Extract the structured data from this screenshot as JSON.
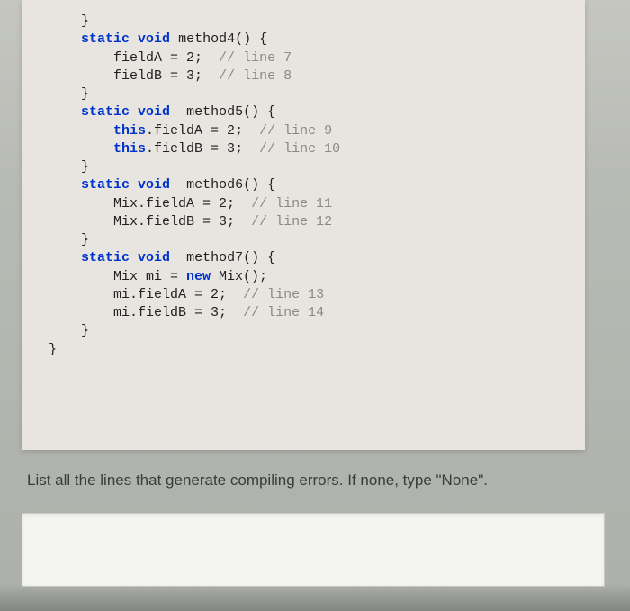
{
  "code": {
    "l0": "    }",
    "blank0": "",
    "m4_sig_indent": "    ",
    "m4_sig_kw1": "static",
    "m4_sig_sp1": " ",
    "m4_sig_kw2": "void",
    "m4_sig_rest": " method4() {",
    "m4_l1": "        fieldA = 2;  // line 7",
    "m4_l1_pre": "        fieldA = ",
    "m4_l1_num": "2",
    "m4_l1_mid": ";  ",
    "m4_l1_cmt": "// line 7",
    "m4_l2_pre": "        fieldB = ",
    "m4_l2_num": "3",
    "m4_l2_mid": ";  ",
    "m4_l2_cmt": "// line 8",
    "m4_close": "    }",
    "blank1": "",
    "m5_sig_indent": "    ",
    "m5_sig_kw1": "static",
    "m5_sig_sp1": " ",
    "m5_sig_kw2": "void",
    "m5_sig_rest": "  method5() {",
    "m5_l1_pre": "        ",
    "m5_l1_this": "this",
    "m5_l1_mid1": ".fieldA = ",
    "m5_l1_num": "2",
    "m5_l1_mid2": ";  ",
    "m5_l1_cmt": "// line 9",
    "m5_l2_pre": "        ",
    "m5_l2_this": "this",
    "m5_l2_mid1": ".fieldB = ",
    "m5_l2_num": "3",
    "m5_l2_mid2": ";  ",
    "m5_l2_cmt": "// line 10",
    "m5_close": "    }",
    "blank2": "",
    "m6_sig_indent": "    ",
    "m6_sig_kw1": "static",
    "m6_sig_sp1": " ",
    "m6_sig_kw2": "void",
    "m6_sig_rest": "  method6() {",
    "m6_l1_pre": "        Mix.fieldA = ",
    "m6_l1_num": "2",
    "m6_l1_mid": ";  ",
    "m6_l1_cmt": "// line 11",
    "m6_l2_pre": "        Mix.fieldB = ",
    "m6_l2_num": "3",
    "m6_l2_mid": ";  ",
    "m6_l2_cmt": "// line 12",
    "m6_close": "    }",
    "blank3": "",
    "m7_sig_indent": "    ",
    "m7_sig_kw1": "static",
    "m7_sig_sp1": " ",
    "m7_sig_kw2": "void",
    "m7_sig_rest": "  method7() {",
    "m7_l0_pre": "        Mix mi = ",
    "m7_l0_new": "new",
    "m7_l0_post": " Mix();",
    "m7_l1_pre": "        mi.fieldA = ",
    "m7_l1_num": "2",
    "m7_l1_mid": ";  ",
    "m7_l1_cmt": "// line 13",
    "m7_l2_pre": "        mi.fieldB = ",
    "m7_l2_num": "3",
    "m7_l2_mid": ";  ",
    "m7_l2_cmt": "// line 14",
    "m7_close": "    }",
    "class_close": "}"
  },
  "question": "List all the lines that generate compiling errors.    If none, type \"None\".",
  "answer_value": ""
}
